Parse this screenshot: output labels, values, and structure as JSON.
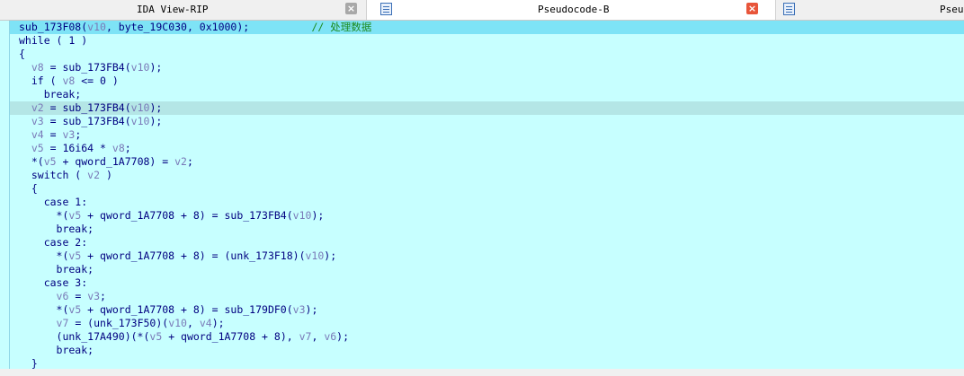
{
  "tabs": [
    {
      "label": "IDA View-RIP",
      "active": false,
      "close": "×"
    },
    {
      "label": "Pseudocode-B",
      "active": true,
      "close": "×"
    },
    {
      "label": "Pseudoc",
      "active": false
    }
  ],
  "colors": {
    "background": "#c7ffff",
    "highlight": "#7ee3f6",
    "code_text": "#000080",
    "variable": "#7a7ab8",
    "comment": "#1e8a1e"
  },
  "code": [
    [
      {
        "t": "sub_173F08("
      },
      {
        "t": "v10",
        "v": 1
      },
      {
        "t": ", byte_19C030, 0x1000);          "
      },
      {
        "t": "// 处理数据",
        "c": 1
      }
    ],
    [
      {
        "t": "while ( 1 )"
      }
    ],
    [
      {
        "t": "{"
      }
    ],
    [
      {
        "t": "  "
      },
      {
        "t": "v8",
        "v": 1
      },
      {
        "t": " = sub_173FB4("
      },
      {
        "t": "v10",
        "v": 1
      },
      {
        "t": ");"
      }
    ],
    [
      {
        "t": "  if ( "
      },
      {
        "t": "v8",
        "v": 1
      },
      {
        "t": " <= 0 )"
      }
    ],
    [
      {
        "t": "    break;"
      }
    ],
    [
      {
        "t": "  "
      },
      {
        "t": "v2",
        "v": 1
      },
      {
        "t": " = sub_173FB4("
      },
      {
        "t": "v10",
        "v": 1
      },
      {
        "t": ");"
      }
    ],
    [
      {
        "t": "  "
      },
      {
        "t": "v3",
        "v": 1
      },
      {
        "t": " = sub_173FB4("
      },
      {
        "t": "v10",
        "v": 1
      },
      {
        "t": ");"
      }
    ],
    [
      {
        "t": "  "
      },
      {
        "t": "v4",
        "v": 1
      },
      {
        "t": " = "
      },
      {
        "t": "v3",
        "v": 1
      },
      {
        "t": ";"
      }
    ],
    [
      {
        "t": "  "
      },
      {
        "t": "v5",
        "v": 1
      },
      {
        "t": " = 16i64 * "
      },
      {
        "t": "v8",
        "v": 1
      },
      {
        "t": ";"
      }
    ],
    [
      {
        "t": "  *("
      },
      {
        "t": "v5",
        "v": 1
      },
      {
        "t": " + qword_1A7708) = "
      },
      {
        "t": "v2",
        "v": 1
      },
      {
        "t": ";"
      }
    ],
    [
      {
        "t": "  switch ( "
      },
      {
        "t": "v2",
        "v": 1
      },
      {
        "t": " )"
      }
    ],
    [
      {
        "t": "  {"
      }
    ],
    [
      {
        "t": "    case 1:"
      }
    ],
    [
      {
        "t": "      *("
      },
      {
        "t": "v5",
        "v": 1
      },
      {
        "t": " + qword_1A7708 + 8) = sub_173FB4("
      },
      {
        "t": "v10",
        "v": 1
      },
      {
        "t": ");"
      }
    ],
    [
      {
        "t": "      break;"
      }
    ],
    [
      {
        "t": "    case 2:"
      }
    ],
    [
      {
        "t": "      *("
      },
      {
        "t": "v5",
        "v": 1
      },
      {
        "t": " + qword_1A7708 + 8) = (unk_173F18)("
      },
      {
        "t": "v10",
        "v": 1
      },
      {
        "t": ");"
      }
    ],
    [
      {
        "t": "      break;"
      }
    ],
    [
      {
        "t": "    case 3:"
      }
    ],
    [
      {
        "t": "      "
      },
      {
        "t": "v6",
        "v": 1
      },
      {
        "t": " = "
      },
      {
        "t": "v3",
        "v": 1
      },
      {
        "t": ";"
      }
    ],
    [
      {
        "t": "      *("
      },
      {
        "t": "v5",
        "v": 1
      },
      {
        "t": " + qword_1A7708 + 8) = sub_179DF0("
      },
      {
        "t": "v3",
        "v": 1
      },
      {
        "t": ");"
      }
    ],
    [
      {
        "t": "      "
      },
      {
        "t": "v7",
        "v": 1
      },
      {
        "t": " = (unk_173F50)("
      },
      {
        "t": "v10",
        "v": 1
      },
      {
        "t": ", "
      },
      {
        "t": "v4",
        "v": 1
      },
      {
        "t": ");"
      }
    ],
    [
      {
        "t": "      (unk_17A490)(*("
      },
      {
        "t": "v5",
        "v": 1
      },
      {
        "t": " + qword_1A7708 + 8), "
      },
      {
        "t": "v7",
        "v": 1
      },
      {
        "t": ", "
      },
      {
        "t": "v6",
        "v": 1
      },
      {
        "t": ");"
      }
    ],
    [
      {
        "t": "      break;"
      }
    ],
    [
      {
        "t": "  }"
      }
    ]
  ]
}
